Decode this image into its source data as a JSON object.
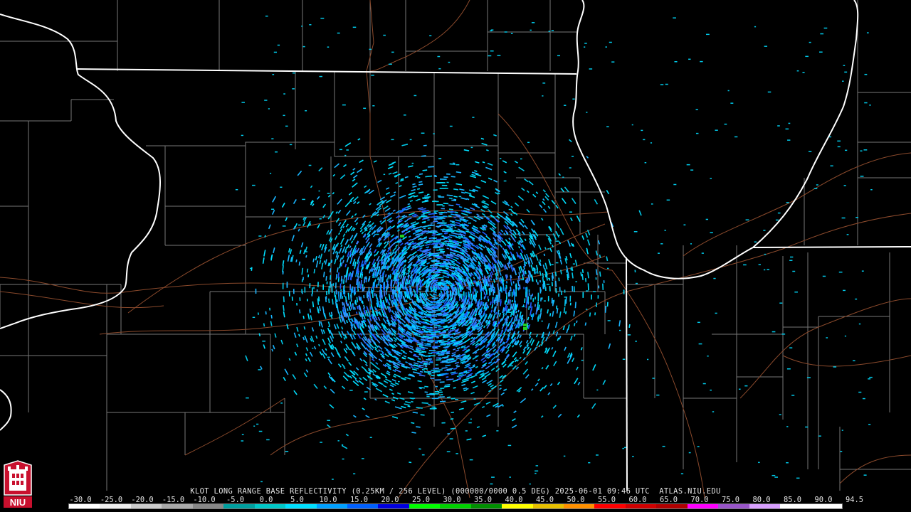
{
  "product_caption": "KLOT LONG RANGE BASE REFLECTIVITY (0.25KM / 256 LEVEL) (000000/0000 0.5 DEG) 2025-06-01 09:46 UTC  ATLAS.NIU.EDU",
  "logo": {
    "text": "NIU",
    "icon": "castle-seal-icon"
  },
  "colors": {
    "background": "#000000",
    "state_border": "#ffffff",
    "county_border": "#8c8c8c",
    "road": "#8b4a2c",
    "caption_text": "#e6e6e6",
    "logo_red": "#c8102e"
  },
  "reflectivity_scale": {
    "labels": [
      "-30.0",
      "-25.0",
      "-20.0",
      "-15.0",
      "-10.0",
      "-5.0",
      "0.0",
      "5.0",
      "10.0",
      "15.0",
      "20.0",
      "25.0",
      "30.0",
      "35.0",
      "40.0",
      "45.0",
      "50.0",
      "55.0",
      "60.0",
      "65.0",
      "70.0",
      "75.0",
      "80.0",
      "85.0",
      "90.0",
      "94.5"
    ],
    "colors": [
      "#ffffff",
      "#eeeeee",
      "#cccccc",
      "#aaaaaa",
      "#888888",
      "#00a0a0",
      "#00c8c8",
      "#00e0ff",
      "#00a0ff",
      "#0060ff",
      "#0000e0",
      "#00ff00",
      "#00d000",
      "#009000",
      "#ffff00",
      "#e6c000",
      "#ff9000",
      "#ff0000",
      "#d00000",
      "#b00000",
      "#ff00ff",
      "#9955c9",
      "#d9a0ff",
      "#ffffff",
      "#ffffff"
    ]
  }
}
